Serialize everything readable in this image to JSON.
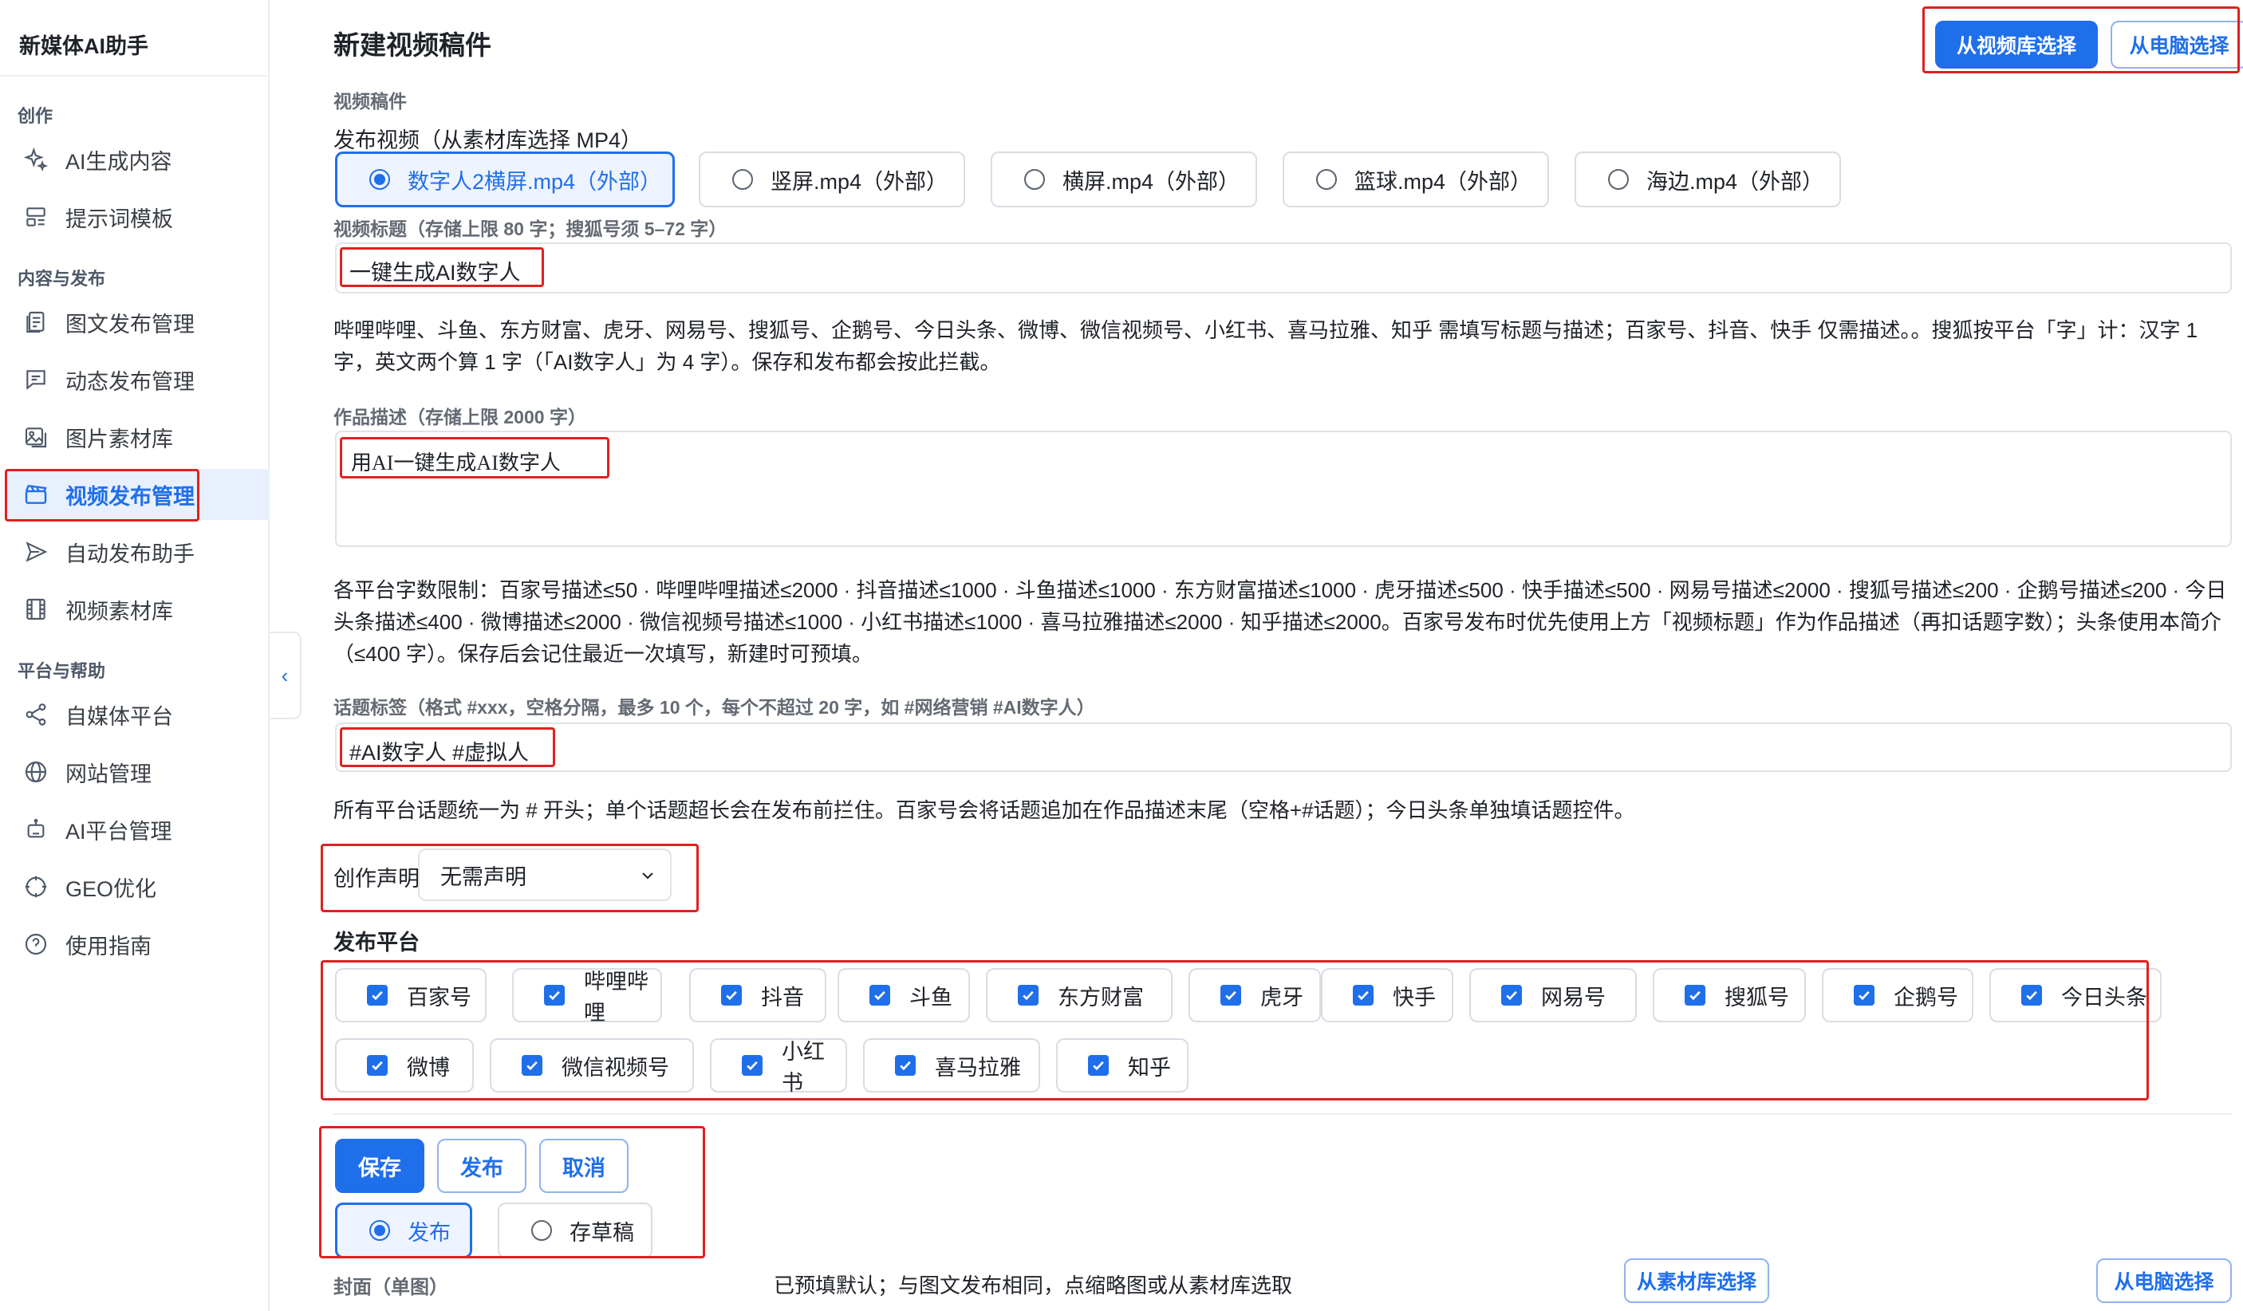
{
  "app_title": "新媒体AI助手",
  "colors": {
    "accent": "#1f6feb",
    "highlight_box": "#e02020",
    "active_nav_bg": "#e8f0fe"
  },
  "sidebar": {
    "sections": [
      {
        "title": "创作",
        "items": [
          {
            "label": "AI生成内容",
            "icon": "sparkle-icon"
          },
          {
            "label": "提示词模板",
            "icon": "template-icon"
          }
        ]
      },
      {
        "title": "内容与发布",
        "items": [
          {
            "label": "图文发布管理",
            "icon": "document-icon"
          },
          {
            "label": "动态发布管理",
            "icon": "message-icon"
          },
          {
            "label": "图片素材库",
            "icon": "image-icon"
          },
          {
            "label": "视频发布管理",
            "icon": "clapperboard-icon",
            "active": true
          },
          {
            "label": "自动发布助手",
            "icon": "send-icon"
          },
          {
            "label": "视频素材库",
            "icon": "film-icon"
          }
        ]
      },
      {
        "title": "平台与帮助",
        "items": [
          {
            "label": "自媒体平台",
            "icon": "share-icon"
          },
          {
            "label": "网站管理",
            "icon": "globe-icon"
          },
          {
            "label": "AI平台管理",
            "icon": "robot-icon"
          },
          {
            "label": "GEO优化",
            "icon": "target-icon"
          },
          {
            "label": "使用指南",
            "icon": "help-icon"
          }
        ]
      }
    ]
  },
  "header": {
    "title": "新建视频稿件",
    "from_library_label": "从视频库选择",
    "from_computer_label": "从电脑选择"
  },
  "video": {
    "section_label": "视频稿件",
    "field_label": "发布视频（从素材库选择 MP4）",
    "options": [
      {
        "label": "数字人2横屏.mp4（外部）",
        "selected": true
      },
      {
        "label": "竖屏.mp4（外部）",
        "selected": false
      },
      {
        "label": "横屏.mp4（外部）",
        "selected": false
      },
      {
        "label": "篮球.mp4（外部）",
        "selected": false
      },
      {
        "label": "海边.mp4（外部）",
        "selected": false
      }
    ]
  },
  "title_field": {
    "label": "视频标题（存储上限 80 字；搜狐号须 5–72 字）",
    "value": "一键生成AI数字人",
    "help": "哔哩哔哩、斗鱼、东方财富、虎牙、网易号、搜狐号、企鹅号、今日头条、微博、微信视频号、小红书、喜马拉雅、知乎 需填写标题与描述；百家号、抖音、快手 仅需描述。。搜狐按平台「字」计：汉字 1 字，英文两个算 1 字（「AI数字人」为 4 字）。保存和发布都会按此拦截。"
  },
  "desc_field": {
    "label": "作品描述（存储上限 2000 字）",
    "value": "用AI一键生成AI数字人",
    "help": "各平台字数限制：百家号描述≤50 · 哔哩哔哩描述≤2000 · 抖音描述≤1000 · 斗鱼描述≤1000 · 东方财富描述≤1000 · 虎牙描述≤500 · 快手描述≤500 · 网易号描述≤2000 · 搜狐号描述≤200 · 企鹅号描述≤200 · 今日头条描述≤400 · 微博描述≤2000 · 微信视频号描述≤1000 · 小红书描述≤1000 · 喜马拉雅描述≤2000 · 知乎描述≤2000。百家号发布时优先使用上方「视频标题」作为作品描述（再扣话题字数）；头条使用本简介（≤400 字）。保存后会记住最近一次填写，新建时可预填。"
  },
  "tags_field": {
    "label": "话题标签（格式 #xxx，空格分隔，最多 10 个，每个不超过 20 字，如 #网络营销 #AI数字人）",
    "value": "#AI数字人 #虚拟人",
    "help": "所有平台话题统一为 # 开头；单个话题超长会在发布前拦住。百家号会将话题追加在作品描述末尾（空格+#话题）；今日头条单独填话题控件。"
  },
  "declaration": {
    "label": "创作声明",
    "value": "无需声明"
  },
  "platforms": {
    "label": "发布平台",
    "items": [
      "百家号",
      "哔哩哔哩",
      "抖音",
      "斗鱼",
      "东方财富",
      "虎牙",
      "快手",
      "网易号",
      "搜狐号",
      "企鹅号",
      "今日头条",
      "微博",
      "微信视频号",
      "小红书",
      "喜马拉雅",
      "知乎"
    ]
  },
  "actions": {
    "save": "保存",
    "publish": "发布",
    "cancel": "取消"
  },
  "mode": {
    "options": [
      {
        "label": "发布",
        "selected": true
      },
      {
        "label": "存草稿",
        "selected": false
      }
    ]
  },
  "cover": {
    "label": "封面（单图）",
    "hint": "已预填默认；与图文发布相同，点缩略图或从素材库选取",
    "from_material_label": "从素材库选择",
    "from_computer_label": "从电脑选择"
  }
}
